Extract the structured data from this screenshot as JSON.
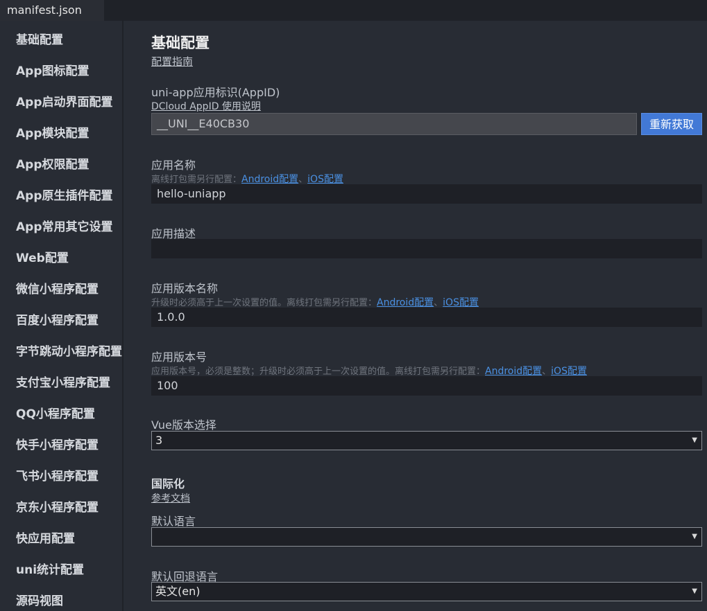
{
  "tab": {
    "title": "manifest.json"
  },
  "sidebar": {
    "items": [
      "基础配置",
      "App图标配置",
      "App启动界面配置",
      "App模块配置",
      "App权限配置",
      "App原生插件配置",
      "App常用其它设置",
      "Web配置",
      "微信小程序配置",
      "百度小程序配置",
      "字节跳动小程序配置",
      "支付宝小程序配置",
      "QQ小程序配置",
      "快手小程序配置",
      "飞书小程序配置",
      "京东小程序配置",
      "快应用配置",
      "uni统计配置",
      "源码视图"
    ]
  },
  "main": {
    "title": "基础配置",
    "guide_link": "配置指南",
    "appid": {
      "label": "uni-app应用标识(AppID)",
      "link": "DCloud AppID 使用说明",
      "value": "__UNI__E40CB30",
      "button": "重新获取"
    },
    "app_name": {
      "label": "应用名称",
      "hint": "离线打包需另行配置：",
      "android_link": "Android配置",
      "sep": "、",
      "ios_link": "iOS配置",
      "value": "hello-uniapp"
    },
    "app_desc": {
      "label": "应用描述",
      "value": ""
    },
    "version_name": {
      "label": "应用版本名称",
      "hint": "升级时必须高于上一次设置的值。离线打包需另行配置：",
      "android_link": "Android配置",
      "sep": "、",
      "ios_link": "iOS配置",
      "value": "1.0.0"
    },
    "version_code": {
      "label": "应用版本号",
      "hint": "应用版本号，必须是整数；升级时必须高于上一次设置的值。离线打包需另行配置：",
      "android_link": "Android配置",
      "sep": "、",
      "ios_link": "iOS配置",
      "value": "100"
    },
    "vue_version": {
      "label": "Vue版本选择",
      "value": "3"
    },
    "i18n": {
      "title": "国际化",
      "doc_link": "参考文档",
      "default_lang_label": "默认语言",
      "default_lang_value": "",
      "fallback_lang_label": "默认回退语言",
      "fallback_lang_value": "英文(en)"
    }
  }
}
